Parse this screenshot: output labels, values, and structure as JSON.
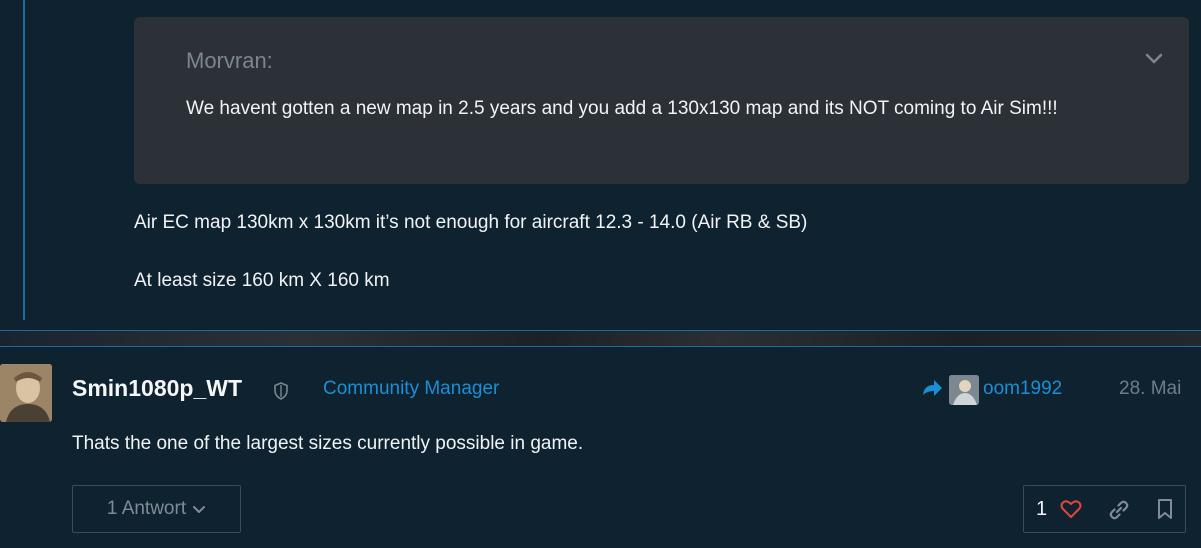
{
  "quote": {
    "author": "Morvran:",
    "text": "We havent gotten a new map in 2.5 years and you add a 130x130 map and its NOT coming to Air Sim!!!"
  },
  "first_post": {
    "lines": [
      "Air EC map 130km x 130km it’s not enough for aircraft 12.3 - 14.0 (Air RB & SB)",
      "At least size 160 km X 160 km"
    ]
  },
  "second_post": {
    "username": "Smin1080p_WT",
    "role": "Community Manager",
    "reply_to": "oom1992",
    "date": "28. Mai",
    "text": "Thats the one of the largest sizes currently possible in game.",
    "replies_label": "1 Antwort",
    "like_count": "1"
  },
  "colors": {
    "accent": "#1a8fd6",
    "heart": "#e0443e",
    "background": "#0f2230",
    "quote_bg": "#2c3137"
  },
  "icons": [
    "chevron-down-icon",
    "shield-icon",
    "reply-arrow-icon",
    "heart-icon",
    "link-icon",
    "bookmark-icon"
  ]
}
